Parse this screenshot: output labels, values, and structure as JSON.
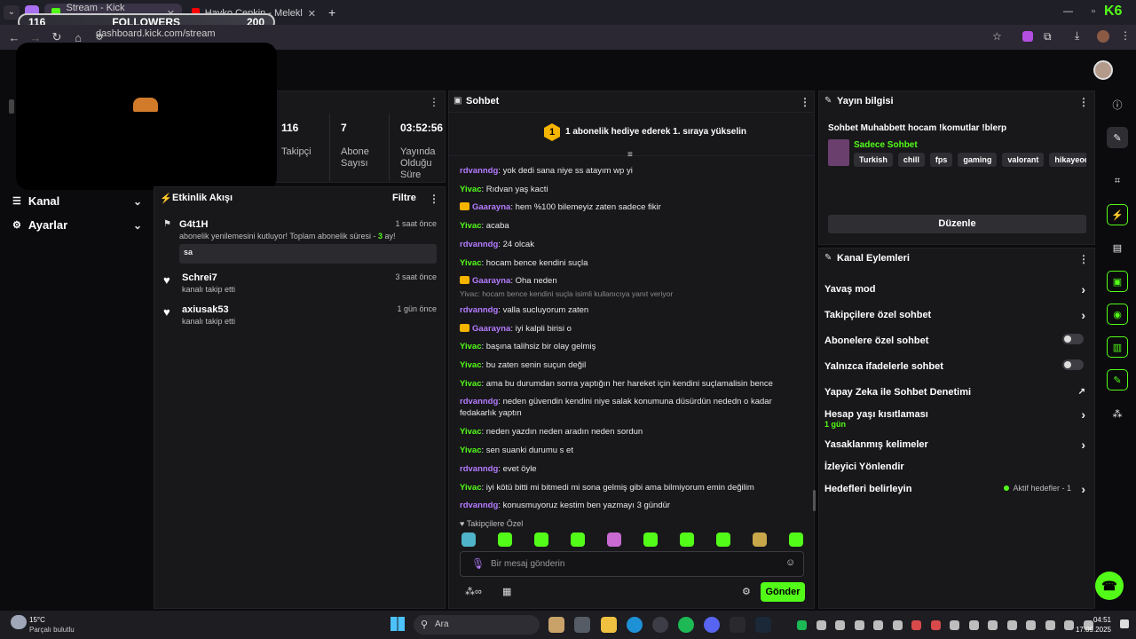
{
  "browser": {
    "tabs": [
      {
        "label": "Stream - Kick Dashboard",
        "active": true
      },
      {
        "label": "Hayko Cepkin - Melekler - YouTube",
        "active": false
      }
    ],
    "url": "dashboard.kick.com/stream",
    "kick_badge": "K6"
  },
  "followers_goal": {
    "current": "116",
    "label": "FOLLOWERS",
    "target": "200",
    "progress": 0.58
  },
  "overlay_video": {
    "logo_text": "stream logo"
  },
  "stats": {
    "followers": {
      "value": "116",
      "label": "Takipçi"
    },
    "subs": {
      "value": "7",
      "label": "Abone Sayısı"
    },
    "uptime": {
      "value": "03:52:56",
      "label": "Yayında Olduğu Süre"
    }
  },
  "sidebar": {
    "items": [
      {
        "label": "Kanal",
        "icon": "list-icon"
      },
      {
        "label": "Ayarlar",
        "icon": "gear-icon"
      }
    ]
  },
  "activity": {
    "title": "Etkinlik Akışı",
    "filter": "Filtre",
    "events": [
      {
        "name": "G4t1H",
        "time": "1 saat önce",
        "desc_prefix": "abonelik yenilemesini kutluyor! Toplam abonelik süresi - ",
        "desc_count": "3",
        "desc_suffix": " ay!",
        "message": "sa"
      },
      {
        "name": "Schrei7",
        "time": "3 saat önce",
        "desc": "kanalı takip etti"
      },
      {
        "name": "axiusak53",
        "time": "1 gün önce",
        "desc": "kanalı takip etti"
      }
    ]
  },
  "chat": {
    "title": "Sohbet",
    "gift_banner": "1 abonelik hediye ederek 1. sıraya yükselin",
    "gift_rank": "1",
    "messages": [
      {
        "user": "rdvanndg",
        "color": "#b57cff",
        "text": "yok dedi sana niye ss atayım wp yi",
        "crown": false
      },
      {
        "user": "Yivac",
        "color": "#53fc18",
        "text": "Rıdvan yaş kacti",
        "crown": false
      },
      {
        "user": "Gaarayna",
        "color": "#b57cff",
        "text": "hem %100 bilemeyiz zaten sadece fikir",
        "crown": true
      },
      {
        "user": "Yivac",
        "color": "#53fc18",
        "text": "acaba",
        "crown": false
      },
      {
        "user": "rdvanndg",
        "color": "#b57cff",
        "text": "24 olcak",
        "crown": false
      },
      {
        "user": "Yivac",
        "color": "#53fc18",
        "text": "hocam bence kendini suçla",
        "crown": false
      },
      {
        "user": "Gaarayna",
        "color": "#b57cff",
        "text": "Oha neden",
        "crown": true
      },
      {
        "user": "rdvanndg",
        "color": "#b57cff",
        "text": "valla sucluyorum zaten",
        "crown": false,
        "reply": "Yivac: hocam bence kendini suçla isimli kullanıcıya yanıt veriyor"
      },
      {
        "user": "Gaarayna",
        "color": "#b57cff",
        "text": "iyi kalpli birisi o",
        "crown": true
      },
      {
        "user": "Yivac",
        "color": "#53fc18",
        "text": "başına talihsiz bir olay gelmiş",
        "crown": false
      },
      {
        "user": "Yivac",
        "color": "#53fc18",
        "text": "bu zaten senin suçun değil",
        "crown": false
      },
      {
        "user": "Yivac",
        "color": "#53fc18",
        "text": "ama bu durumdan sonra yaptığın her hareket için kendini suçlamalisin bence",
        "crown": false
      },
      {
        "user": "rdvanndg",
        "color": "#b57cff",
        "text": "neden güvendin kendini niye salak konumuna düsürdün nededn o kadar fedakarlık yaptın",
        "crown": false
      },
      {
        "user": "Yivac",
        "color": "#53fc18",
        "text": "neden yazdın neden aradın neden sordun",
        "crown": false
      },
      {
        "user": "Yivac",
        "color": "#53fc18",
        "text": "sen suanki durumu s et",
        "crown": false
      },
      {
        "user": "rdvanndg",
        "color": "#b57cff",
        "text": "evet öyle",
        "crown": false
      },
      {
        "user": "Yivac",
        "color": "#53fc18",
        "text": "iyi kötü bitti mi bitmedi mi sona gelmiş gibi ama bilmiyorum emin değilim",
        "crown": false
      },
      {
        "user": "rdvanndg",
        "color": "#b57cff",
        "text": "konusmuyoruz kestim ben yazmayı 3 gündür",
        "crown": false
      }
    ],
    "followers_only": "Takipçilere Özel",
    "placeholder": "Bir mesaj gönderin",
    "send": "Gönder"
  },
  "stream_info": {
    "title": "Yayın bilgisi",
    "stream_title": "Sohbet Muhabbett hocam !komutlar !blerp",
    "category": "Sadece Sohbet",
    "tags": [
      "Turkish",
      "chill",
      "fps",
      "gaming",
      "valorant",
      "hikayeodaklıoyu"
    ],
    "edit": "Düzenle"
  },
  "channel_actions": {
    "title": "Kanal Eylemleri",
    "items": [
      {
        "label": "Yavaş mod",
        "type": "arrow"
      },
      {
        "label": "Takipçilere özel sohbet",
        "type": "arrow"
      },
      {
        "label": "Abonelere özel sohbet",
        "type": "toggle"
      },
      {
        "label": "Yalnızca ifadelerle sohbet",
        "type": "toggle"
      },
      {
        "label": "Yapay Zeka ile Sohbet Denetimi",
        "type": "external"
      },
      {
        "label": "Hesap yaşı kısıtlaması",
        "type": "arrow",
        "sub": "1 gün"
      },
      {
        "label": "Yasaklanmış kelimeler",
        "type": "arrow"
      },
      {
        "label": "İzleyici Yönlendir",
        "type": "none"
      },
      {
        "label": "Hedefleri belirleyin",
        "type": "arrow",
        "status": "Aktif hedefler - 1"
      }
    ]
  },
  "taskbar": {
    "weather_temp": "15°C",
    "weather_desc": "Parçalı bulutlu",
    "search": "Ara",
    "time": "04:51",
    "date": "17.09.2025"
  },
  "colors": {
    "accent": "#53fc18",
    "purple": "#b57cff",
    "gold": "#f5b400"
  }
}
